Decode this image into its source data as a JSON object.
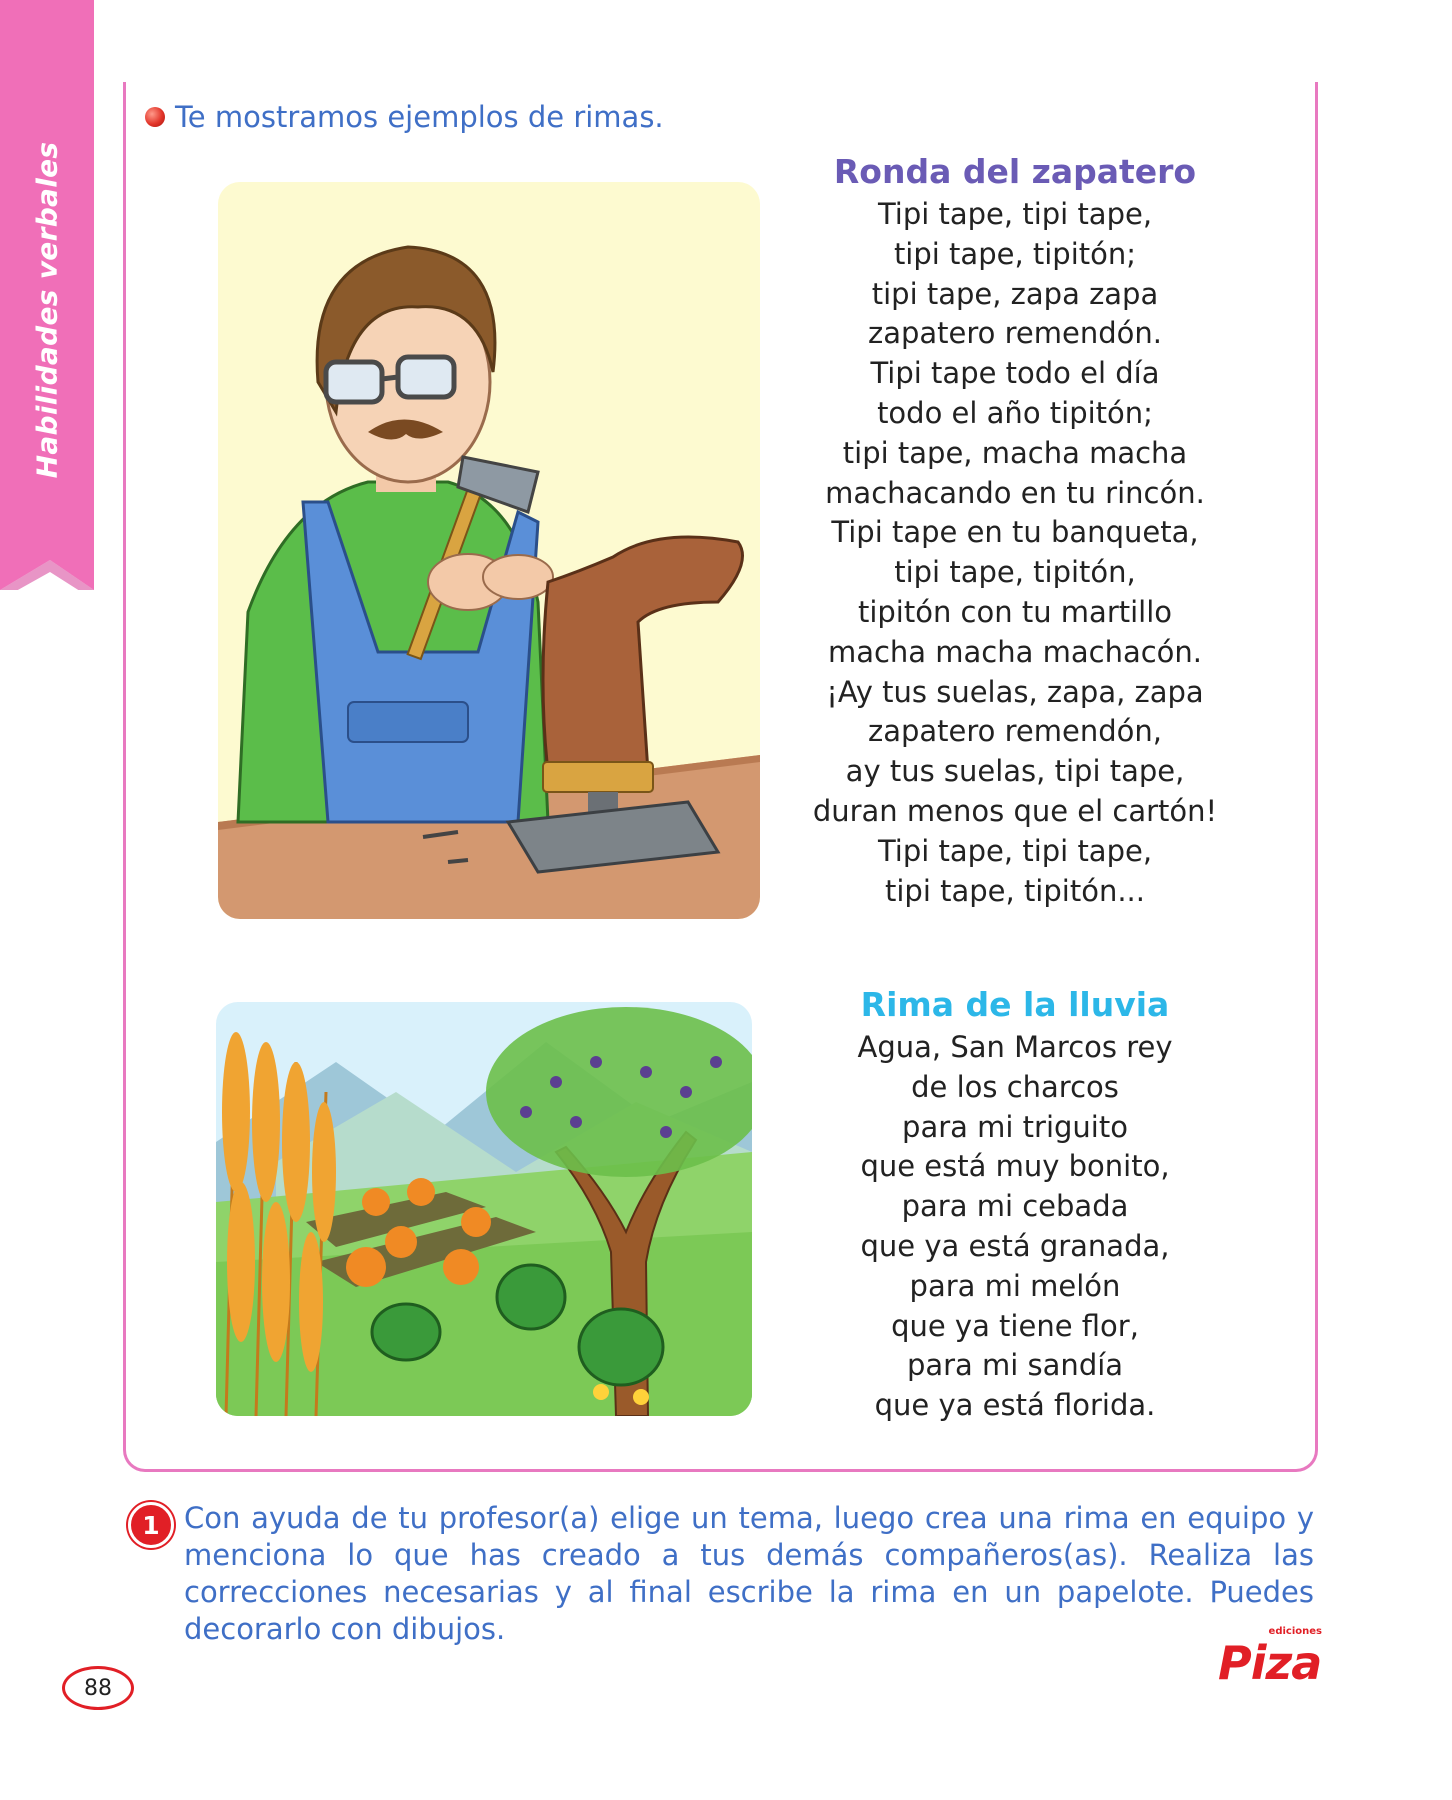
{
  "sidebar": {
    "section_label": "Habilidades verbales"
  },
  "intro": {
    "text": "Te mostramos ejemplos de rimas."
  },
  "poems": [
    {
      "title": "Ronda del zapatero",
      "lines": [
        "Tipi tape, tipi tape,",
        "tipi tape, tipitón;",
        "tipi tape, zapa zapa",
        "zapatero remendón.",
        "Tipi tape todo el día",
        "todo el año tipitón;",
        "tipi tape, macha macha",
        "machacando en tu rincón.",
        "Tipi tape en tu banqueta,",
        "tipi tape, tipitón,",
        "tipitón con tu martillo",
        "macha macha machacón.",
        "¡Ay tus suelas, zapa, zapa",
        "zapatero remendón,",
        "ay tus suelas, tipi tape,",
        "duran menos que el cartón!",
        "Tipi tape, tipi tape,",
        "tipi tape, tipitón..."
      ]
    },
    {
      "title": "Rima de la lluvia",
      "lines": [
        "Agua, San Marcos rey",
        "de los charcos",
        "para mi triguito",
        "que está muy bonito,",
        "para mi cebada",
        "que ya está granada,",
        "para mi melón",
        "que ya tiene flor,",
        "para mi sandía",
        "que ya está florida."
      ]
    }
  ],
  "activity": {
    "number": "1",
    "text": "Con ayuda de tu profesor(a) elige un tema, luego crea una rima en equipo y menciona lo que has creado a tus demás compañeros(as). Realiza las correcciones necesarias y al final escribe la rima en un papelote. Puedes decorarlo con dibujos."
  },
  "footer": {
    "page_number": "88",
    "logo_small": "ediciones",
    "logo_main": "Piza"
  },
  "colors": {
    "tab": "#f06fb8",
    "frame": "#e879c0",
    "accent_text": "#3f6fc6",
    "title_1": "#6a5bb5",
    "title_2": "#2cb7e8",
    "brand_red": "#e11f26"
  }
}
